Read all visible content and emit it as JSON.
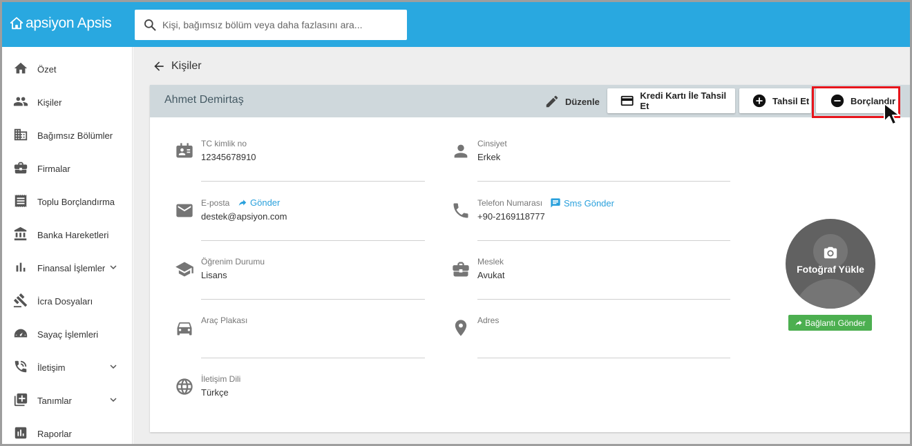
{
  "app": {
    "logo": "apsiyon Apsis"
  },
  "search": {
    "placeholder": "Kişi, bağımsız bölüm veya daha fazlasını ara..."
  },
  "sidebar": {
    "items": [
      {
        "label": "Özet",
        "icon": "home-icon"
      },
      {
        "label": "Kişiler",
        "icon": "people-icon"
      },
      {
        "label": "Bağımsız Bölümler",
        "icon": "building-icon"
      },
      {
        "label": "Firmalar",
        "icon": "briefcase-icon"
      },
      {
        "label": "Toplu Borçlandırma",
        "icon": "receipt-icon"
      },
      {
        "label": "Banka Hareketleri",
        "icon": "bank-icon"
      },
      {
        "label": "Finansal İşlemler",
        "icon": "bar-chart-icon"
      },
      {
        "label": "İcra Dosyaları",
        "icon": "gavel-icon"
      },
      {
        "label": "Sayaç İşlemleri",
        "icon": "meter-icon"
      },
      {
        "label": "İletişim",
        "icon": "phone-icon"
      },
      {
        "label": "Tanımlar",
        "icon": "library-add-icon"
      },
      {
        "label": "Raporlar",
        "icon": "report-icon"
      }
    ]
  },
  "page": {
    "back_label": "Kişiler"
  },
  "person": {
    "name": "Ahmet Demirtaş",
    "edit_label": "Düzenle",
    "buttons": {
      "credit_card": "Kredi Kartı İle Tahsil Et",
      "collect": "Tahsil Et",
      "debit": "Borçlandır"
    }
  },
  "fields": {
    "tc": {
      "label": "TC kimlik no",
      "value": "12345678910"
    },
    "gender": {
      "label": "Cinsiyet",
      "value": "Erkek"
    },
    "email": {
      "label": "E-posta",
      "value": "destek@apsiyon.com",
      "action": "Gönder"
    },
    "phone": {
      "label": "Telefon Numarası",
      "value": "+90-2169118777",
      "action": "Sms Gönder"
    },
    "education": {
      "label": "Öğrenim Durumu",
      "value": "Lisans"
    },
    "job": {
      "label": "Meslek",
      "value": "Avukat"
    },
    "plate": {
      "label": "Araç Plakası",
      "value": ""
    },
    "address": {
      "label": "Adres",
      "value": ""
    },
    "language": {
      "label": "İletişim Dili",
      "value": "Türkçe"
    }
  },
  "photo": {
    "label": "Fotoğraf Yükle",
    "link_button": "Bağlantı Gönder"
  },
  "colors": {
    "topbar": "#29a8e0",
    "header": "#cfd8dc",
    "highlight": "#e8141b",
    "success": "#4caf50",
    "link": "#29a0dc"
  }
}
